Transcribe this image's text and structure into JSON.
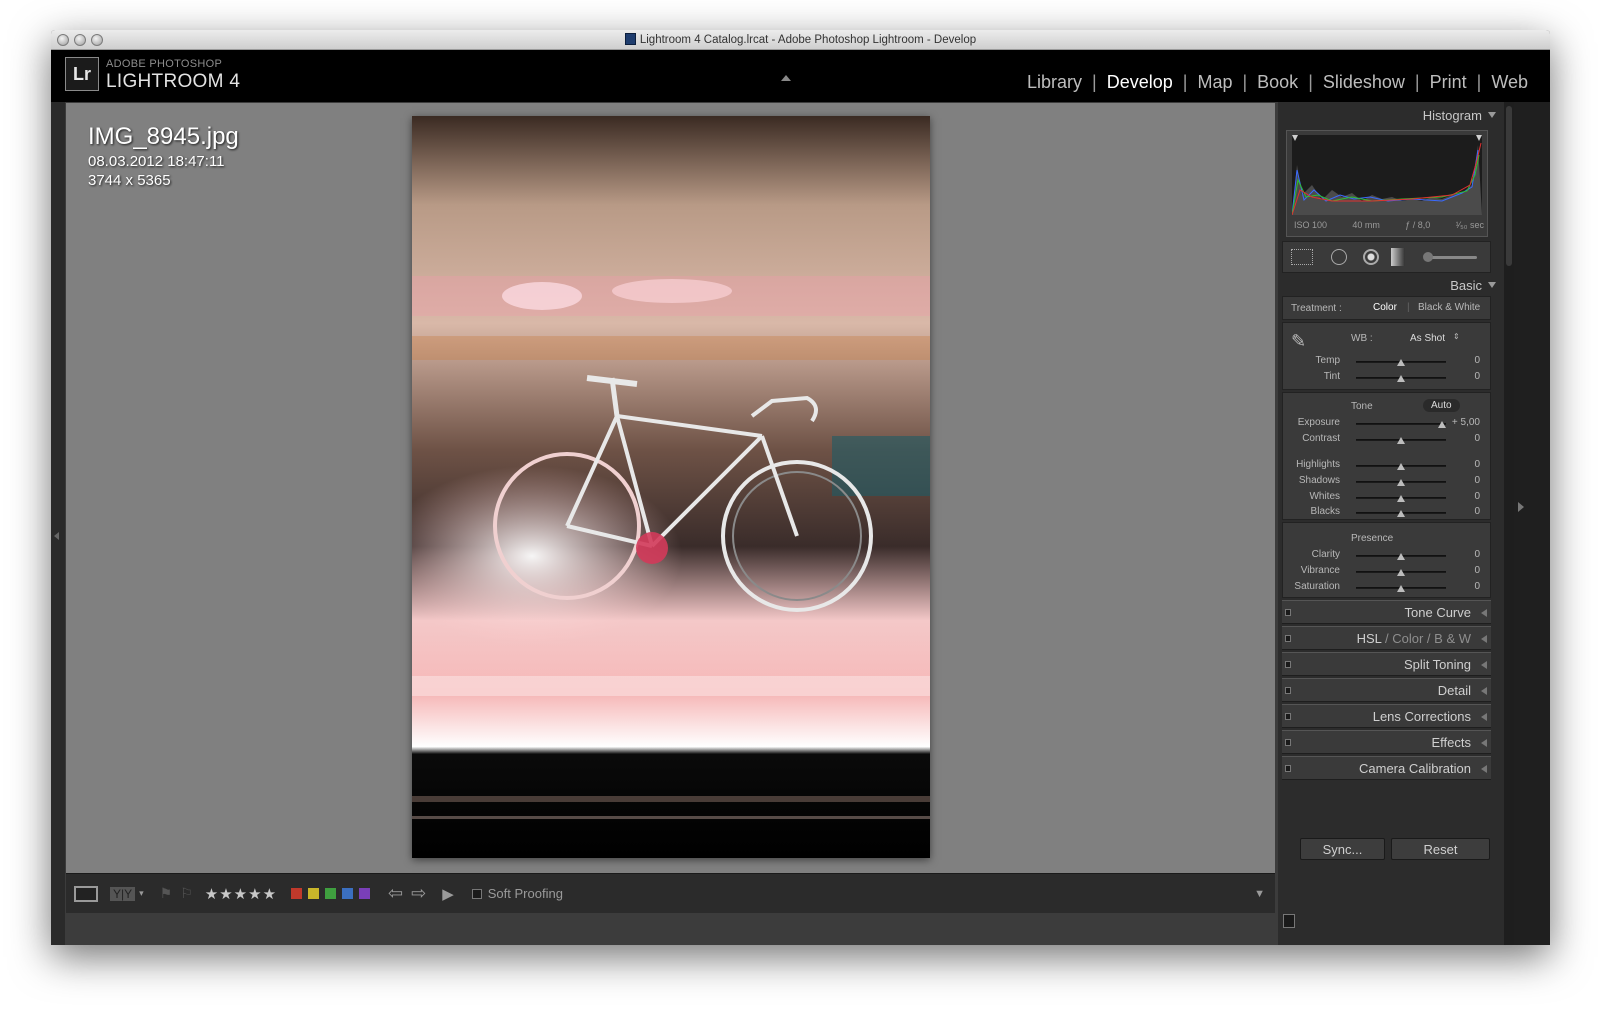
{
  "window": {
    "title": "Lightroom 4 Catalog.lrcat - Adobe Photoshop Lightroom - Develop"
  },
  "header": {
    "brand_small": "ADOBE PHOTOSHOP",
    "brand_big": "LIGHTROOM 4",
    "badge": "Lr",
    "modules": [
      "Library",
      "Develop",
      "Map",
      "Book",
      "Slideshow",
      "Print",
      "Web"
    ],
    "active_module": "Develop"
  },
  "photo_info": {
    "filename": "IMG_8945.jpg",
    "datetime": "08.03.2012 18:47:11",
    "dimensions": "3744 x 5365"
  },
  "toolbar": {
    "stars": "★★★★★",
    "soft_proofing_label": "Soft Proofing",
    "soft_proofing_checked": false,
    "color_labels": [
      "#c0392b",
      "#c9b62a",
      "#3f9f3f",
      "#3b6fc0",
      "#7a3fb8"
    ]
  },
  "histogram": {
    "title": "Histogram",
    "iso": "ISO 100",
    "focal": "40 mm",
    "aperture": "ƒ / 8,0",
    "shutter": "¹⁄₅₀ sec"
  },
  "basic": {
    "title": "Basic",
    "treatment_label": "Treatment :",
    "treatment_color": "Color",
    "treatment_bw": "Black & White",
    "wb_label": "WB :",
    "wb_value": "As Shot",
    "tone_label": "Tone",
    "auto_label": "Auto",
    "presence_label": "Presence",
    "sliders": [
      {
        "label": "Temp",
        "value": "0",
        "level": 0.5
      },
      {
        "label": "Tint",
        "value": "0",
        "level": 0.5
      },
      {
        "label": "Exposure",
        "value": "+ 5,00",
        "level": 0.95
      },
      {
        "label": "Contrast",
        "value": "0",
        "level": 0.5
      },
      {
        "label": "Highlights",
        "value": "0",
        "level": 0.5
      },
      {
        "label": "Shadows",
        "value": "0",
        "level": 0.5
      },
      {
        "label": "Whites",
        "value": "0",
        "level": 0.5
      },
      {
        "label": "Blacks",
        "value": "0",
        "level": 0.5
      },
      {
        "label": "Clarity",
        "value": "0",
        "level": 0.5
      },
      {
        "label": "Vibrance",
        "value": "0",
        "level": 0.5
      },
      {
        "label": "Saturation",
        "value": "0",
        "level": 0.5
      }
    ]
  },
  "panels": {
    "tone_curve": "Tone Curve",
    "hsl_1": "HSL",
    "hsl_2": "Color",
    "hsl_3": "B & W",
    "split_toning": "Split Toning",
    "detail": "Detail",
    "lens_corrections": "Lens Corrections",
    "effects": "Effects",
    "camera_calibration": "Camera Calibration"
  },
  "buttons": {
    "sync": "Sync...",
    "reset": "Reset"
  }
}
